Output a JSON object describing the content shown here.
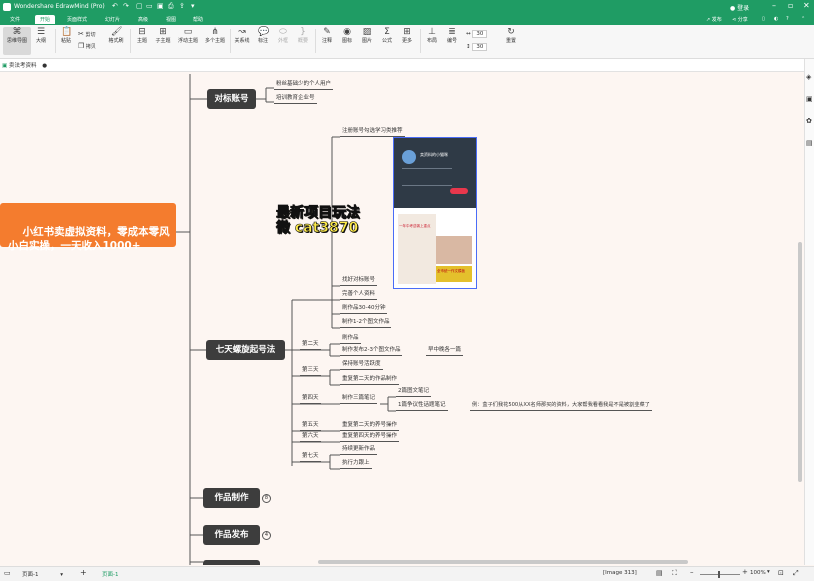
{
  "titlebar": {
    "app_title": "Wondershare EdrawMind (Pro)",
    "login_label": "登录",
    "colors": {
      "bg": "#1f9c64"
    }
  },
  "menubar": {
    "items": [
      "文件",
      "开始",
      "页面样式",
      "幻灯片",
      "高级",
      "视图",
      "帮助"
    ],
    "right": {
      "publish": "发布",
      "share": "分享"
    }
  },
  "ribbon": {
    "items": [
      {
        "label": "思维导图",
        "icon": "mindmap-icon"
      },
      {
        "label": "大纲",
        "icon": "outline-icon"
      },
      {
        "label": "粘贴",
        "icon": "paste-icon"
      },
      {
        "label": "剪切",
        "icon": "cut-icon"
      },
      {
        "label": "拷贝",
        "icon": "copy-icon"
      },
      {
        "label": "格式刷",
        "icon": "format-painter-icon"
      },
      {
        "label": "主题",
        "icon": "topic-icon"
      },
      {
        "label": "子主题",
        "icon": "subtopic-icon"
      },
      {
        "label": "浮动主题",
        "icon": "floating-topic-icon"
      },
      {
        "label": "多个主题",
        "icon": "multiple-topics-icon"
      },
      {
        "label": "关系线",
        "icon": "relationship-icon"
      },
      {
        "label": "标注",
        "icon": "callout-icon"
      },
      {
        "label": "外框",
        "icon": "boundary-icon"
      },
      {
        "label": "概要",
        "icon": "summary-icon"
      },
      {
        "label": "注释",
        "icon": "note-icon"
      },
      {
        "label": "图标",
        "icon": "clipart-icon"
      },
      {
        "label": "图片",
        "icon": "image-icon"
      },
      {
        "label": "公式",
        "icon": "formula-icon"
      },
      {
        "label": "更多",
        "icon": "more-icon"
      },
      {
        "label": "布局",
        "icon": "layout-icon"
      },
      {
        "label": "编号",
        "icon": "numbering-icon"
      },
      {
        "label": "重置",
        "icon": "reset-icon"
      }
    ],
    "spacing_values": [
      "30",
      "30"
    ]
  },
  "doc_tab": {
    "label": "卖法考资料"
  },
  "mindmap": {
    "central": "小红书卖虚拟资料，零成本零风\n小白实操，一天收入1000+",
    "topics": {
      "t1": "对标账号",
      "t2": "七天螺旋起号法",
      "t3": "作品制作",
      "t4": "作品发布"
    },
    "t1_subs": [
      "粉丝基础少的个人用户",
      "培训教育企业号"
    ],
    "t2_subs": {
      "register": "注册账号勾选学习类推荐",
      "find": "找好对标账号",
      "complete": "完善个人资料",
      "browse": "刷作品30-40分钟",
      "make": "制作1-2个图文作品",
      "day2": "第二天",
      "day2_a": "刷作品",
      "day2_b": "制作发布2-3个图文作品",
      "day2_b_note": "早中晚各一篇",
      "day3": "第三天",
      "day3_a": "保持账号活跃度",
      "day3_b": "重复第二天的作品制作",
      "day4": "第四天",
      "day4_a": "制作三篇笔记",
      "day4_a1": "2篇图文笔记",
      "day4_a2": "1篇争议性话题笔记",
      "day4_a2_note": "例：盒子们我花500从XX名师那买的资料，大家帮我看看我是不是被割韭菜了",
      "day5": "第五天",
      "day5_a": "重复第二天的养号操作",
      "day6": "第六天",
      "day6_a": "重复第四天的养号操作",
      "day7": "第七天",
      "day7_a": "持续更新作品",
      "day7_b": "执行力跟上"
    },
    "badges": {
      "t3": "8",
      "t4": "4"
    },
    "overlay_text": "最新项目玩法\n微 cat3870",
    "embedded_image": {
      "profile_caption": "卖资料的小猫咪",
      "promo_line": "一年中考逆袭上重点",
      "ad_text": "全市统一作文模板"
    }
  },
  "status": {
    "page_selector": "页面-1",
    "active_page": "页面-1",
    "image_info": "[Image 313]",
    "zoom": "100%"
  }
}
